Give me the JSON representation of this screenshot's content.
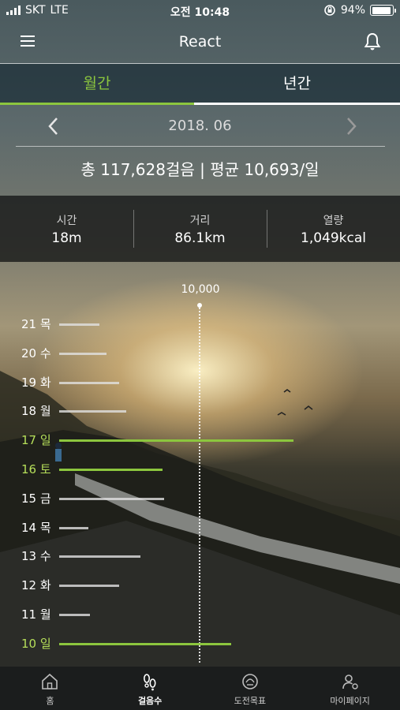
{
  "status_bar": {
    "carrier": "SKT",
    "network": "LTE",
    "time": "오전 10:48",
    "battery": "94%",
    "battery_level": 0.94
  },
  "header": {
    "title": "React",
    "menu_icon": "menu-icon",
    "bell_icon": "bell-icon"
  },
  "tabs": [
    {
      "label": "월간",
      "active": true
    },
    {
      "label": "년간",
      "active": false
    }
  ],
  "month_nav": {
    "label": "2018. 06"
  },
  "summary": "총 117,628걸음 | 평균 10,693/일",
  "stats": [
    {
      "label": "시간",
      "value": "18m"
    },
    {
      "label": "거리",
      "value": "86.1km"
    },
    {
      "label": "열량",
      "value": "1,049kcal"
    }
  ],
  "chart_data": {
    "type": "bar",
    "orientation": "horizontal",
    "goal_label": "10,000",
    "goal_value": 10000,
    "hit_color": "#8cc63e",
    "base_color": "#e1e1e1",
    "categories": [
      "21 목",
      "20 수",
      "19 화",
      "18 월",
      "17 일",
      "16 토",
      "15 금",
      "14 목",
      "13 수",
      "12 화",
      "11 월",
      "10 일"
    ],
    "values": [
      2900,
      3400,
      4300,
      4800,
      16800,
      7400,
      7500,
      2100,
      5800,
      4300,
      2200,
      12300
    ],
    "goal_reached": [
      false,
      false,
      false,
      false,
      true,
      true,
      false,
      false,
      false,
      false,
      false,
      true
    ]
  },
  "bottom_nav": [
    {
      "label": "홈",
      "icon": "home-icon",
      "active": false
    },
    {
      "label": "걸음수",
      "icon": "footsteps-icon",
      "active": true
    },
    {
      "label": "도전목표",
      "icon": "trophy-icon",
      "active": false
    },
    {
      "label": "마이페이지",
      "icon": "user-settings-icon",
      "active": false
    }
  ]
}
